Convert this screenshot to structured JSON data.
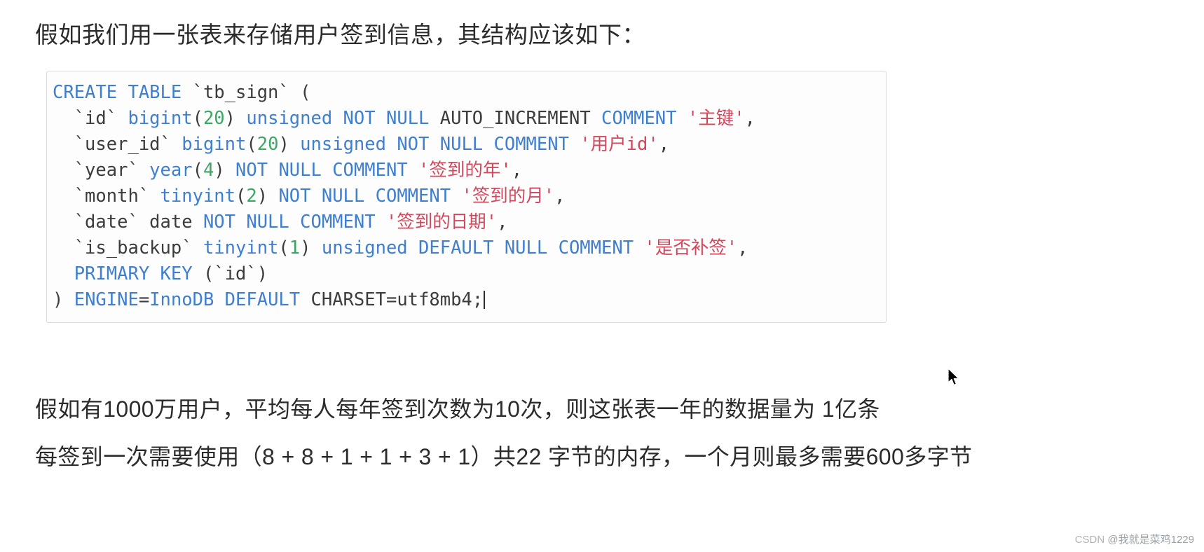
{
  "intro": {
    "text": "假如我们用一张表来存储用户签到信息，其结构应该如下："
  },
  "code_block": {
    "language": "sql",
    "caret_visible": true,
    "colors": {
      "keyword": "#3f7fd0",
      "type": "#3f7fd0",
      "number": "#3aa763",
      "string": "#d3475c",
      "identifier": "#3c3c3c",
      "background": "#fdfdfd",
      "border": "#d8dce0"
    },
    "lines": [
      {
        "id": "line-1",
        "tokens": [
          {
            "t": "CREATE TABLE ",
            "c": "kw"
          },
          {
            "t": "`tb_sign` (",
            "c": "ident"
          }
        ]
      },
      {
        "id": "line-2",
        "tokens": [
          {
            "t": "  `id` ",
            "c": "ident"
          },
          {
            "t": "bigint",
            "c": "typ"
          },
          {
            "t": "(",
            "c": "plain"
          },
          {
            "t": "20",
            "c": "num"
          },
          {
            "t": ") ",
            "c": "plain"
          },
          {
            "t": "unsigned NOT NULL ",
            "c": "kw"
          },
          {
            "t": "AUTO_INCREMENT ",
            "c": "plain"
          },
          {
            "t": "COMMENT ",
            "c": "kw"
          },
          {
            "t": "'主键'",
            "c": "str"
          },
          {
            "t": ",",
            "c": "plain"
          }
        ]
      },
      {
        "id": "line-3",
        "tokens": [
          {
            "t": "  `user_id` ",
            "c": "ident"
          },
          {
            "t": "bigint",
            "c": "typ"
          },
          {
            "t": "(",
            "c": "plain"
          },
          {
            "t": "20",
            "c": "num"
          },
          {
            "t": ") ",
            "c": "plain"
          },
          {
            "t": "unsigned NOT NULL COMMENT ",
            "c": "kw"
          },
          {
            "t": "'用户id'",
            "c": "str"
          },
          {
            "t": ",",
            "c": "plain"
          }
        ]
      },
      {
        "id": "line-4",
        "tokens": [
          {
            "t": "  `year` ",
            "c": "ident"
          },
          {
            "t": "year",
            "c": "typ"
          },
          {
            "t": "(",
            "c": "plain"
          },
          {
            "t": "4",
            "c": "num"
          },
          {
            "t": ") ",
            "c": "plain"
          },
          {
            "t": "NOT NULL COMMENT ",
            "c": "kw"
          },
          {
            "t": "'签到的年'",
            "c": "str"
          },
          {
            "t": ",",
            "c": "plain"
          }
        ]
      },
      {
        "id": "line-5",
        "tokens": [
          {
            "t": "  `month` ",
            "c": "ident"
          },
          {
            "t": "tinyint",
            "c": "typ"
          },
          {
            "t": "(",
            "c": "plain"
          },
          {
            "t": "2",
            "c": "num"
          },
          {
            "t": ") ",
            "c": "plain"
          },
          {
            "t": "NOT NULL COMMENT ",
            "c": "kw"
          },
          {
            "t": "'签到的月'",
            "c": "str"
          },
          {
            "t": ",",
            "c": "plain"
          }
        ]
      },
      {
        "id": "line-6",
        "tokens": [
          {
            "t": "  `date` date ",
            "c": "ident"
          },
          {
            "t": "NOT NULL COMMENT ",
            "c": "kw"
          },
          {
            "t": "'签到的日期'",
            "c": "str"
          },
          {
            "t": ",",
            "c": "plain"
          }
        ]
      },
      {
        "id": "line-7",
        "tokens": [
          {
            "t": "  `is_backup` ",
            "c": "ident"
          },
          {
            "t": "tinyint",
            "c": "typ"
          },
          {
            "t": "(",
            "c": "plain"
          },
          {
            "t": "1",
            "c": "num"
          },
          {
            "t": ") ",
            "c": "plain"
          },
          {
            "t": "unsigned DEFAULT NULL COMMENT ",
            "c": "kw"
          },
          {
            "t": "'是否补签'",
            "c": "str"
          },
          {
            "t": ",",
            "c": "plain"
          }
        ]
      },
      {
        "id": "line-8",
        "tokens": [
          {
            "t": "  PRIMARY KEY ",
            "c": "kw"
          },
          {
            "t": "(`id`)",
            "c": "ident"
          }
        ]
      },
      {
        "id": "line-9",
        "tokens": [
          {
            "t": ") ",
            "c": "plain"
          },
          {
            "t": "ENGINE",
            "c": "kw"
          },
          {
            "t": "=",
            "c": "plain"
          },
          {
            "t": "InnoDB DEFAULT ",
            "c": "kw"
          },
          {
            "t": "CHARSET=utf8mb4;",
            "c": "plain"
          }
        ]
      }
    ]
  },
  "summary": {
    "line_1": "假如有1000万用户，平均每人每年签到次数为10次，则这张表一年的数据量为 1亿条",
    "line_2": "每签到一次需要使用（8 + 8 + 1 + 1 + 3 + 1）共22 字节的内存，一个月则最多需要600多字节"
  },
  "watermark": {
    "brand": "CSDN",
    "author": "@我就是菜鸡1229"
  }
}
